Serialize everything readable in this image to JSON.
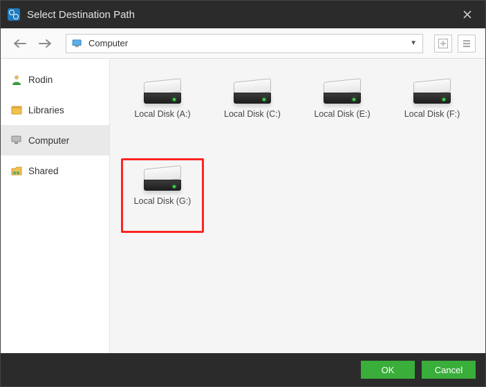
{
  "titlebar": {
    "title": "Select Destination Path"
  },
  "path": {
    "current": "Computer"
  },
  "sidebar": {
    "items": [
      {
        "label": "Rodin"
      },
      {
        "label": "Libraries"
      },
      {
        "label": "Computer"
      },
      {
        "label": "Shared"
      }
    ],
    "selected_index": 2
  },
  "content": {
    "items": [
      {
        "label": "Local Disk (A:)"
      },
      {
        "label": "Local Disk (C:)"
      },
      {
        "label": "Local Disk (E:)"
      },
      {
        "label": "Local Disk (F:)"
      },
      {
        "label": "Local Disk (G:)"
      }
    ],
    "selected_index": 4
  },
  "footer": {
    "ok_label": "OK",
    "cancel_label": "Cancel"
  },
  "colors": {
    "accent_green": "#3aae3a",
    "highlight_red": "#f22",
    "titlebar_bg": "#2b2b2b"
  }
}
